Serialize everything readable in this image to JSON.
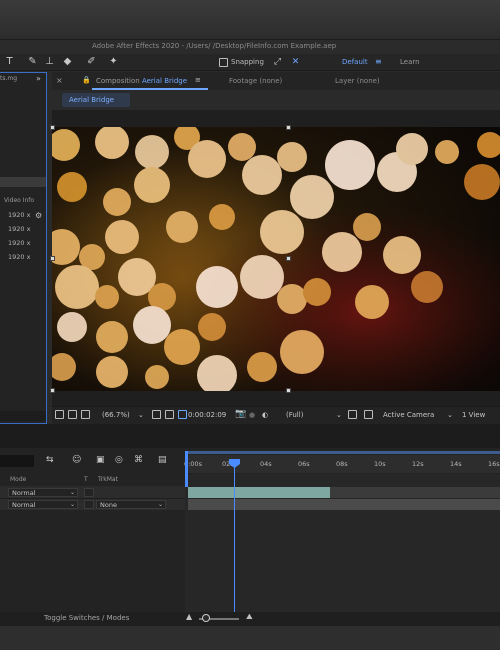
{
  "window": {
    "title": "Adobe After Effects 2020 - /Users/        /Desktop/FileInfo.com Example.aep"
  },
  "toolbar": {
    "snapping_label": "Snapping",
    "workspace_default": "Default",
    "workspace_learn": "Learn",
    "icons": [
      "type-tool-icon",
      "brush-tool-icon",
      "clone-stamp-icon",
      "eraser-tool-icon",
      "roto-brush-icon",
      "puppet-pin-icon"
    ]
  },
  "project_panel": {
    "tab_label": "ts.mg",
    "video_info_header": "Video Info",
    "rows": [
      "1920 x",
      "1920 x",
      "1920 x",
      "1920 x"
    ]
  },
  "viewer": {
    "tab_prefix": "Composition",
    "comp_name": "Aerial Bridge",
    "footage_tab": "Footage (none)",
    "layer_tab": "Layer (none)",
    "breadcrumb": "Aerial Bridge",
    "zoom": "(66.7%)",
    "timecode": "0:00:02:09",
    "resolution": "(Full)",
    "camera": "Active Camera",
    "views": "1 View"
  },
  "timeline": {
    "ruler_labels": [
      "0:00s",
      "02s",
      "04s",
      "06s",
      "08s",
      "10s",
      "12s",
      "14s",
      "16s"
    ],
    "columns": {
      "mode": "Mode",
      "t": "T",
      "trkmat": "TrkMat"
    },
    "layers": [
      {
        "mode": "Normal",
        "trkmat": ""
      },
      {
        "mode": "Normal",
        "trkmat": "None"
      }
    ],
    "toggle_label": "Toggle Switches / Modes",
    "playhead_time_s": 2.4
  },
  "colors": {
    "accent_blue": "#6fa6ff",
    "playhead": "#4a8cff",
    "track_teal": "#7fa7a1"
  }
}
